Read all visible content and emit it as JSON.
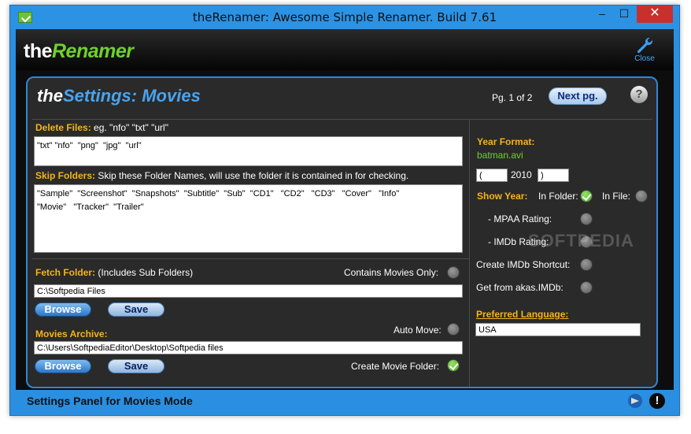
{
  "window": {
    "title": "theRenamer: Awesome Simple Renamer. Build 7.61",
    "min_glyph": "–",
    "max_glyph": "☐",
    "close_glyph": "✕"
  },
  "header": {
    "logo_the": "the",
    "logo_renamer": "Renamer",
    "close_label": "Close"
  },
  "panel": {
    "title_the": "the",
    "title_rest": "Settings: Movies",
    "page_text": "Pg. 1 of 2",
    "next_label": "Next pg.",
    "help_glyph": "?"
  },
  "delete_files": {
    "label": "Delete Files:",
    "hint": " eg. \"nfo\"   \"txt\"   \"url\"",
    "value": "\"txt\" \"nfo\"  \"png\"  \"jpg\"  \"url\""
  },
  "skip_folders": {
    "label": "Skip Folders:",
    "hint": " Skip these Folder Names, will use the folder it is contained in for checking.",
    "value": "\"Sample\"  \"Screenshot\"  \"Snapshots\"  \"Subtitle\"  \"Sub\"  \"CD1\"   \"CD2\"   \"CD3\"   \"Cover\"   \"Info\"\n\"Movie\"   \"Tracker\"  \"Trailer\""
  },
  "fetch_folder": {
    "label": "Fetch Folder:",
    "hint": "  (Includes Sub Folders)",
    "contains_only_label": "Contains Movies Only:",
    "value": "C:\\Softpedia Files",
    "browse_label": "Browse",
    "save_label": "Save"
  },
  "movies_archive": {
    "label": "Movies Archive:",
    "auto_move_label": "Auto Move:",
    "value": "C:\\Users\\SoftpediaEditor\\Desktop\\Softpedia files",
    "browse_label": "Browse",
    "save_label": "Save",
    "create_folder_label": "Create Movie Folder:"
  },
  "year_format": {
    "label": "Year Format:",
    "example": "batman.avi",
    "prefix": "(",
    "year": "2010",
    "suffix": ")"
  },
  "show_year": {
    "label": "Show Year:",
    "in_folder_label": "In Folder:",
    "in_file_label": "In File:",
    "mpaa_label": "- MPAA Rating:",
    "imdb_label": "- IMDb Rating:",
    "shortcut_label": "Create IMDb Shortcut:",
    "akas_label": "Get from akas.IMDb:"
  },
  "language": {
    "label": "Preferred Language:",
    "value": "USA"
  },
  "status": {
    "text": "Settings Panel for Movies Mode",
    "warn_glyph": "!"
  },
  "watermark": "SOFTPEDIA",
  "colors": {
    "accent_blue": "#2a8fe0",
    "orange_label": "#f6b419",
    "green": "#6ed12c"
  }
}
